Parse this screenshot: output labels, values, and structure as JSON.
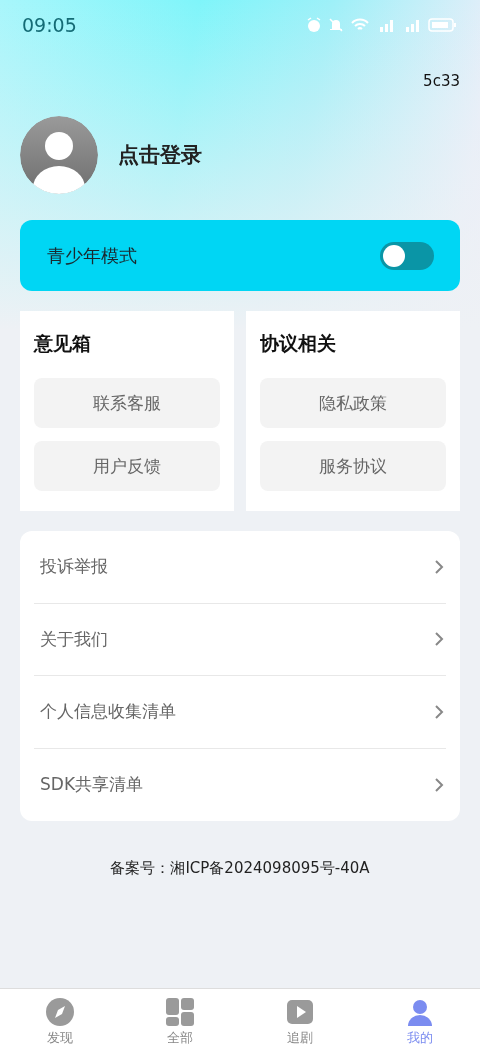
{
  "status_bar": {
    "time": "09:05"
  },
  "version": "5c33",
  "profile": {
    "login_label": "点击登录"
  },
  "youth_mode": {
    "label": "青少年模式",
    "on": false
  },
  "panels": [
    {
      "title": "意见箱",
      "buttons": [
        "联系客服",
        "用户反馈"
      ]
    },
    {
      "title": "协议相关",
      "buttons": [
        "隐私政策",
        "服务协议"
      ]
    }
  ],
  "menu": [
    "投诉举报",
    "关于我们",
    "个人信息收集清单",
    "SDK共享清单"
  ],
  "record_number": "备案号：湘ICP备2024098095号-40A",
  "tabs": [
    {
      "label": "发现",
      "kind": "compass",
      "selected": false
    },
    {
      "label": "全部",
      "kind": "grid",
      "selected": false
    },
    {
      "label": "追剧",
      "kind": "play",
      "selected": false
    },
    {
      "label": "我的",
      "kind": "person",
      "selected": true
    }
  ]
}
